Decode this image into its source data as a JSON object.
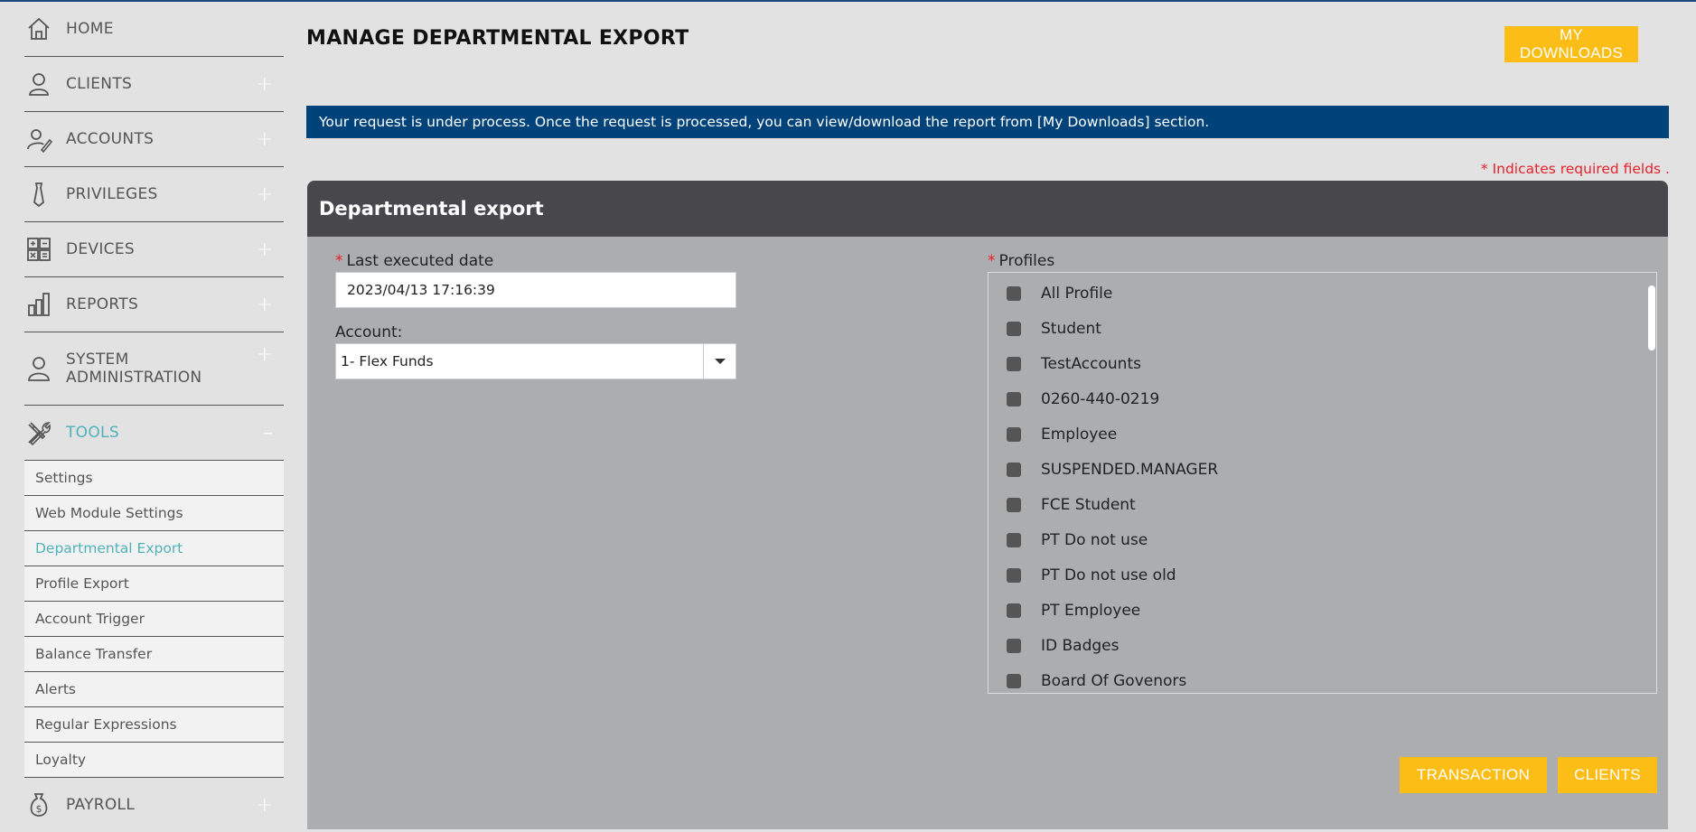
{
  "sidebar": {
    "items": [
      {
        "label": "HOME",
        "icon": "home-icon"
      },
      {
        "label": "CLIENTS",
        "icon": "user-icon"
      },
      {
        "label": "ACCOUNTS",
        "icon": "user-edit-icon"
      },
      {
        "label": "PRIVILEGES",
        "icon": "tie-icon"
      },
      {
        "label": "DEVICES",
        "icon": "calculator-icon"
      },
      {
        "label": "REPORTS",
        "icon": "bar-chart-icon"
      },
      {
        "label": "SYSTEM ADMINISTRATION",
        "icon": "admin-user-icon"
      },
      {
        "label": "TOOLS",
        "icon": "tools-icon"
      },
      {
        "label": "PAYROLL",
        "icon": "money-bag-icon"
      }
    ],
    "expand_symbol": "+",
    "collapse_symbol": "–",
    "tools_sub": [
      "Settings",
      "Web Module Settings",
      "Departmental Export",
      "Profile Export",
      "Account Trigger",
      "Balance Transfer",
      "Alerts",
      "Regular Expressions",
      "Loyalty"
    ]
  },
  "header": {
    "title": "MANAGE DEPARTMENTAL EXPORT",
    "downloads_button": "MY DOWNLOADS"
  },
  "info_message": "Your request is under process. Once the request is processed, you can view/download the report from [My Downloads] section.",
  "required_note": "* Indicates required fields .",
  "panel": {
    "title": "Departmental export",
    "required_star": "*",
    "last_executed_label": "Last executed date",
    "last_executed_value": "2023/04/13 17:16:39",
    "account_label": "Account:",
    "account_value": "1- Flex Funds",
    "profiles_label": "Profiles",
    "profiles": [
      "All Profile",
      "Student",
      "TestAccounts",
      "0260-440-0219",
      "Employee",
      "SUSPENDED.MANAGER",
      "FCE Student",
      "PT Do not use",
      "PT Do not use old",
      "PT Employee",
      "ID Badges",
      "Board Of Govenors"
    ],
    "transaction_button": "TRANSACTION",
    "clients_button": "CLIENTS"
  },
  "colors": {
    "accent_yellow": "#fcbd16",
    "info_blue": "#00427a",
    "active_teal": "#4fb2b8",
    "panel_header": "#48484c",
    "required_red": "#e8212b"
  }
}
